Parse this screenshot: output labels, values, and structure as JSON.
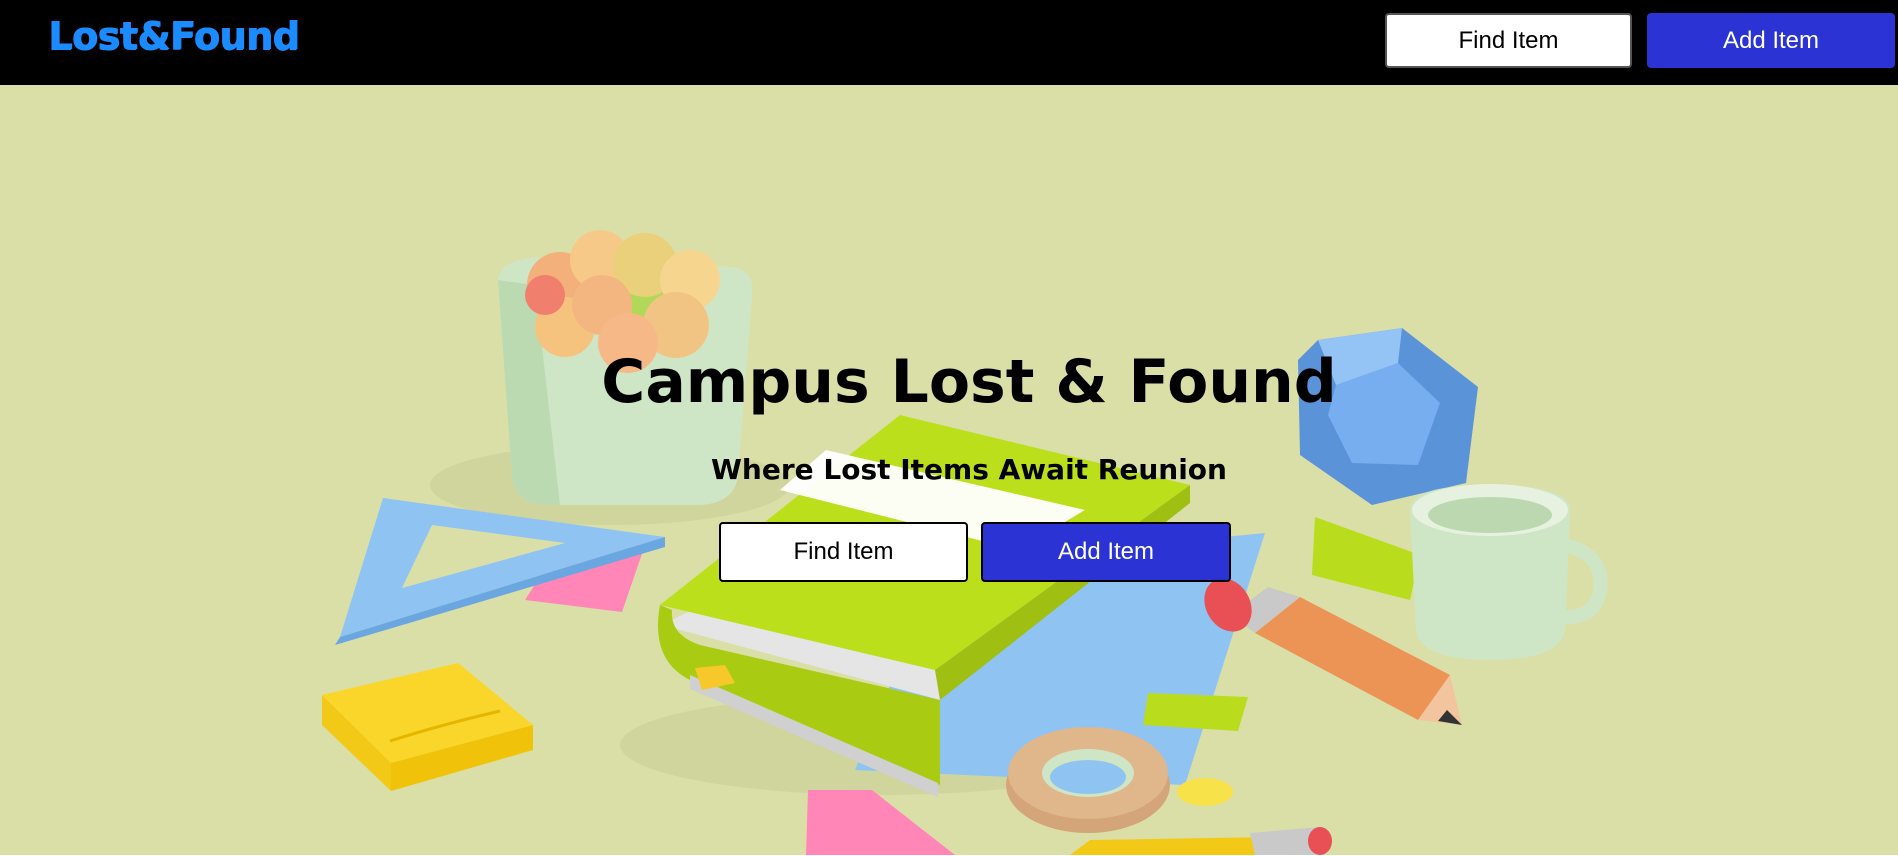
{
  "navbar": {
    "logo": "Lost&Found",
    "find_label": "Find Item",
    "add_label": "Add Item"
  },
  "hero": {
    "title": "Campus Lost & Found",
    "subtitle": "Where Lost Items Await Reunion",
    "find_label": "Find Item",
    "add_label": "Add Item"
  },
  "colors": {
    "navbar_bg": "#000000",
    "logo": "#1a8cff",
    "accent_button": "#2b33d4",
    "hero_bg": "#dadfa8"
  }
}
